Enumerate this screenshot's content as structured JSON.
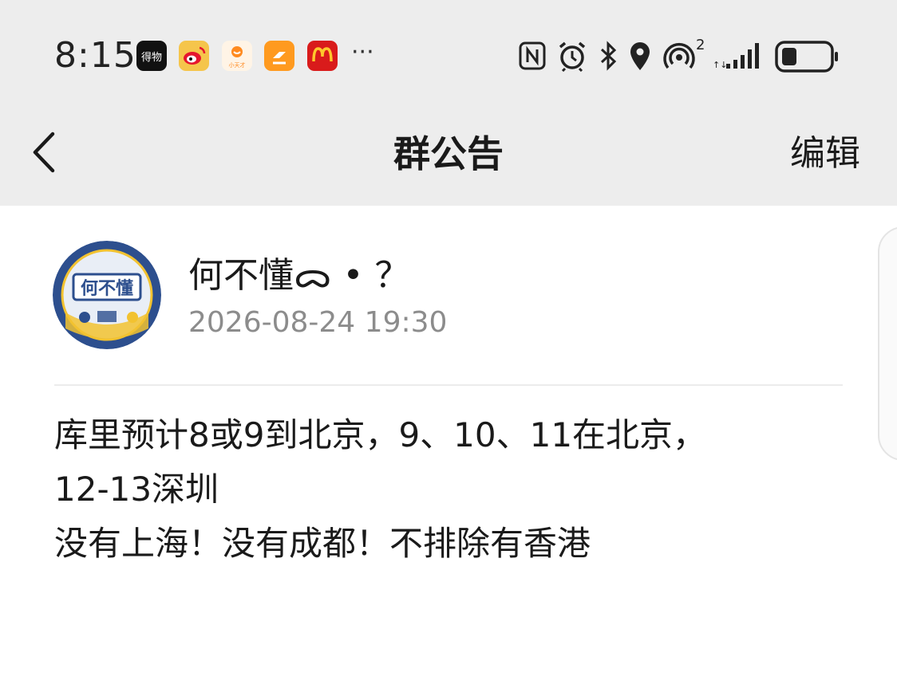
{
  "status_bar": {
    "time": "8:15",
    "app_icons": [
      {
        "name": "dewu-app-icon",
        "label": "得物",
        "color": "#111111"
      },
      {
        "name": "weibo-app-icon",
        "label": "",
        "color": "#f5c54b"
      },
      {
        "name": "xiaotiancai-app-icon",
        "label": "小天才",
        "color": "#fff4e6"
      },
      {
        "name": "orange-app-icon",
        "label": "",
        "color": "#ff9a1f"
      },
      {
        "name": "mcdonalds-app-icon",
        "label": "",
        "color": "#d91b1b"
      }
    ],
    "more_indicator": "···",
    "system_icons": [
      "nfc-icon",
      "alarm-icon",
      "bluetooth-icon",
      "location-icon",
      "hotspot-icon",
      "signal-icon",
      "battery-icon"
    ],
    "hotspot_superscript": "2"
  },
  "nav": {
    "title": "群公告",
    "edit_label": "编辑"
  },
  "post": {
    "author_name": "何不懂ᯅ • ？",
    "avatar_text": "何不懂",
    "timestamp": "2026-08-24 19:30",
    "body_lines": [
      "库里预计8或9到北京，9、10、11在北京，",
      "12-13深圳",
      "没有上海！没有成都！不排除有香港"
    ]
  },
  "colors": {
    "top_background": "#ededed",
    "page_background": "#ffffff",
    "secondary_text": "#8c8c8c",
    "avatar_ring": "#2d4f8e"
  }
}
